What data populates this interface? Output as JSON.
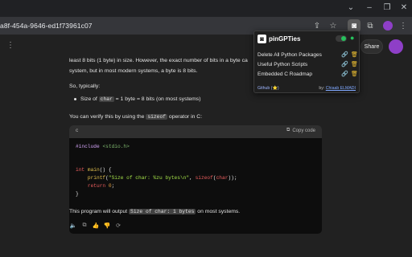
{
  "browser": {
    "url_fragment": "a8f-454a-9646-ed1f73961c07"
  },
  "header": {
    "share_label": "Share"
  },
  "message": {
    "line1": "least 8 bits (1 byte) in size. However, the exact number of bits in a byte ca",
    "line2": "system, but in most modern systems, a byte is 8 bits.",
    "so_typically": "So, typically:",
    "bullet_pre": "Size of ",
    "bullet_code": "char",
    "bullet_post": " = 1 byte = 8 bits (on most systems)",
    "verify_pre": "You can verify this by using the ",
    "verify_code": "sizeof",
    "verify_post": " operator in C:",
    "codeblock": {
      "lang": "c",
      "copy_label": "Copy code"
    },
    "output_pre": "This program will output ",
    "output_code": "Size of char: 1 bytes",
    "output_post": " on most systems."
  },
  "popup": {
    "title": "pinGPTies",
    "items": [
      {
        "label": "Delete All Python Packages"
      },
      {
        "label": "Useful Python Scripts"
      },
      {
        "label": "Embedded C Roadmap"
      }
    ],
    "footer_link": "Github (⭐)",
    "by_label": "by:",
    "author": "Chiaab ELMADI"
  },
  "colors": {
    "accent_green": "#26c15c",
    "link_blue": "#2e79ff",
    "trash_yellow": "#f1c232"
  }
}
